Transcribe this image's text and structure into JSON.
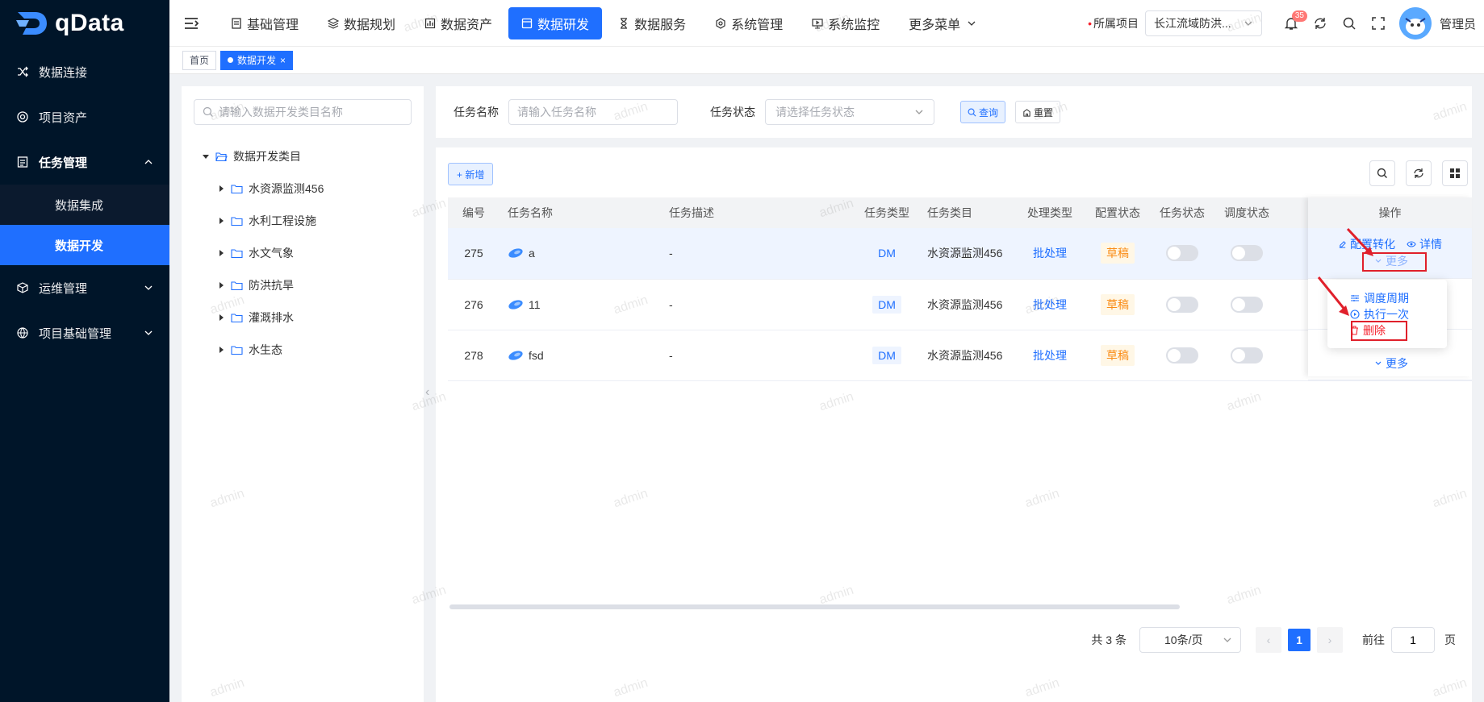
{
  "app": {
    "name": "qData"
  },
  "colors": {
    "primary": "#1f6fff",
    "sidebar": "#001529",
    "danger": "#e0202b",
    "warning": "#fa8c16"
  },
  "sidebar": {
    "items": [
      {
        "label": "数据连接",
        "icon": "shuffle-icon"
      },
      {
        "label": "项目资产",
        "icon": "target-icon"
      },
      {
        "label": "任务管理",
        "icon": "list-icon",
        "expanded": true,
        "children": [
          {
            "label": "数据集成"
          },
          {
            "label": "数据开发",
            "active": true
          }
        ]
      },
      {
        "label": "运维管理",
        "icon": "cube-icon"
      },
      {
        "label": "项目基础管理",
        "icon": "globe-icon"
      }
    ]
  },
  "topnav": {
    "tabs": [
      {
        "label": "基础管理",
        "icon": "doc-icon"
      },
      {
        "label": "数据规划",
        "icon": "layers-icon"
      },
      {
        "label": "数据资产",
        "icon": "chart-icon"
      },
      {
        "label": "数据研发",
        "icon": "window-icon",
        "active": true
      },
      {
        "label": "数据服务",
        "icon": "hourglass-icon"
      },
      {
        "label": "系统管理",
        "icon": "settings-icon"
      },
      {
        "label": "系统监控",
        "icon": "monitor-icon"
      },
      {
        "label": "更多菜单",
        "icon": "chevron-down-icon"
      }
    ],
    "project_label": "所属项目",
    "project_value": "长江流域防洪...",
    "notif_count": "35",
    "username": "管理员"
  },
  "tabs": [
    {
      "label": "首页"
    },
    {
      "label": "数据开发",
      "active": true
    }
  ],
  "tree": {
    "search_placeholder": "请输入数据开发类目名称",
    "root": "数据开发类目",
    "children": [
      "水资源监测456",
      "水利工程设施",
      "水文气象",
      "防洪抗旱",
      "灌溉排水",
      "水生态"
    ]
  },
  "search": {
    "name_label": "任务名称",
    "name_placeholder": "请输入任务名称",
    "status_label": "任务状态",
    "status_placeholder": "请选择任务状态",
    "query_button": "查询",
    "reset_button": "重置"
  },
  "toolbar": {
    "add_button": "+ 新增"
  },
  "table": {
    "columns": [
      "编号",
      "任务名称",
      "任务描述",
      "任务类型",
      "任务类目",
      "处理类型",
      "配置状态",
      "任务状态",
      "调度状态",
      "操作"
    ],
    "rows": [
      {
        "id": "275",
        "name": "a",
        "desc": "-",
        "type": "DM",
        "category": "水资源监测456",
        "process": "批处理",
        "config": "草稿",
        "task_on": false,
        "sched_on": false
      },
      {
        "id": "276",
        "name": "11",
        "desc": "-",
        "type": "DM",
        "category": "水资源监测456",
        "process": "批处理",
        "config": "草稿",
        "task_on": false,
        "sched_on": false
      },
      {
        "id": "278",
        "name": "fsd",
        "desc": "-",
        "type": "DM",
        "category": "水资源监测456",
        "process": "批处理",
        "config": "草稿",
        "task_on": false,
        "sched_on": false
      }
    ],
    "actions": {
      "convert": "配置转化",
      "detail": "详情",
      "more": "更多"
    }
  },
  "dropdown": {
    "items": [
      "调度周期",
      "执行一次",
      "删除"
    ]
  },
  "pagination": {
    "total": "共 3 条",
    "page_size": "10条/页",
    "current": "1",
    "goto_label": "前往",
    "goto_value": "1",
    "page_unit": "页"
  },
  "watermark": "admin"
}
